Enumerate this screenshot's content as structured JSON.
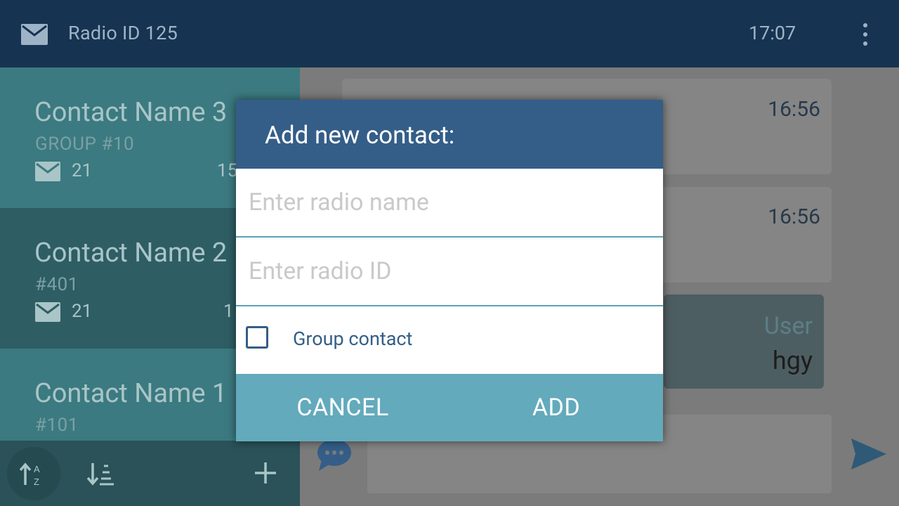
{
  "header": {
    "title": "Radio ID 125",
    "time": "17:07"
  },
  "contacts": [
    {
      "name": "Contact Name 3",
      "sub": "GROUP #10",
      "count": "21",
      "time": "15:"
    },
    {
      "name": "Contact Name 2",
      "sub": "#401",
      "count": "21",
      "time": "1"
    },
    {
      "name": "Contact Name 1",
      "sub": "#101"
    }
  ],
  "messages": [
    {
      "time": "16:56"
    },
    {
      "time": "16:56"
    },
    {
      "user": "User",
      "text": "hgy"
    }
  ],
  "dialog": {
    "title": "Add new contact:",
    "name_placeholder": "Enter radio name",
    "id_placeholder": "Enter radio ID",
    "group_label": "Group contact",
    "cancel": "CANCEL",
    "add": "ADD"
  },
  "icons": {
    "mail": "mail-icon",
    "more": "more-vert-icon",
    "sort_az": "sort-alpha-icon",
    "sort_num": "sort-numeric-icon",
    "add": "plus-icon",
    "chat": "chat-bubble-icon",
    "send": "send-icon"
  },
  "colors": {
    "header_bg": "#163451",
    "dialog_header": "#345e88",
    "button_row": "#63aabc"
  }
}
